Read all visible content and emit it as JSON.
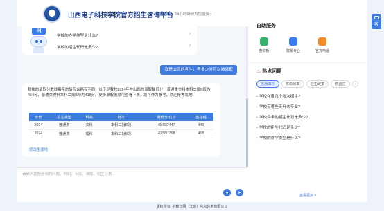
{
  "header": {
    "title": "山西电子科技学院官方招生咨询平台",
    "brand_tag": "智能小E",
    "slogan": "24小时竭诚为您服务~"
  },
  "side_button": {
    "label": "客"
  },
  "bot_card": {
    "robot_sign": "问",
    "questions": [
      "学校的办学类型是什么?",
      "学校的招生代码是多少?"
    ]
  },
  "user_message": "我是山西的考生，考多少分可以被录取",
  "answer": {
    "text": "我校的录取分数线每年的情况会略有不同，以下是我校2024年在山西的录取最低分，普通类文科本科二批B段为454分，普通类理科本科二批B段为418分。更多录取信息可查看下表，您可作为参考，欢迎报考我校!",
    "table": {
      "headers": [
        "年份",
        "招生类型",
        "科类",
        "批次",
        "最低分/位次",
        "省控线"
      ],
      "rows": [
        [
          "2024",
          "普通类",
          "文科",
          "本科二批B段",
          "454/32447",
          "446"
        ],
        [
          "2024",
          "普通类",
          "理科",
          "本科二批B段",
          "423/97398",
          "418"
        ]
      ]
    },
    "link": "修改生源地"
  },
  "input": {
    "placeholder": "请输入您想咨询的问题。例如：专业、录取、招生计划...",
    "value": ""
  },
  "panel": {
    "services_title": "自助服务",
    "services": [
      {
        "label": "查询板",
        "color": "#37b26c"
      },
      {
        "label": "院系专业",
        "color": "#3a7df0"
      },
      {
        "label": "官方电话",
        "color": "#f08a24"
      }
    ],
    "hot_title": "热点问题",
    "tabs": [
      "志愿填报",
      "奖助政策",
      "招生政策",
      "校园生"
    ],
    "hot_questions": [
      "学校在哪几个批次招生?",
      "学校有哪些专升本专业?",
      "学校今年的招生计划是多少?",
      "学校的招生代码是多少?",
      "学校的办学类型是什么?"
    ],
    "more": "查看更多 >"
  },
  "footer": "版权所有: 中教智网（北京）信息技术有限公司"
}
